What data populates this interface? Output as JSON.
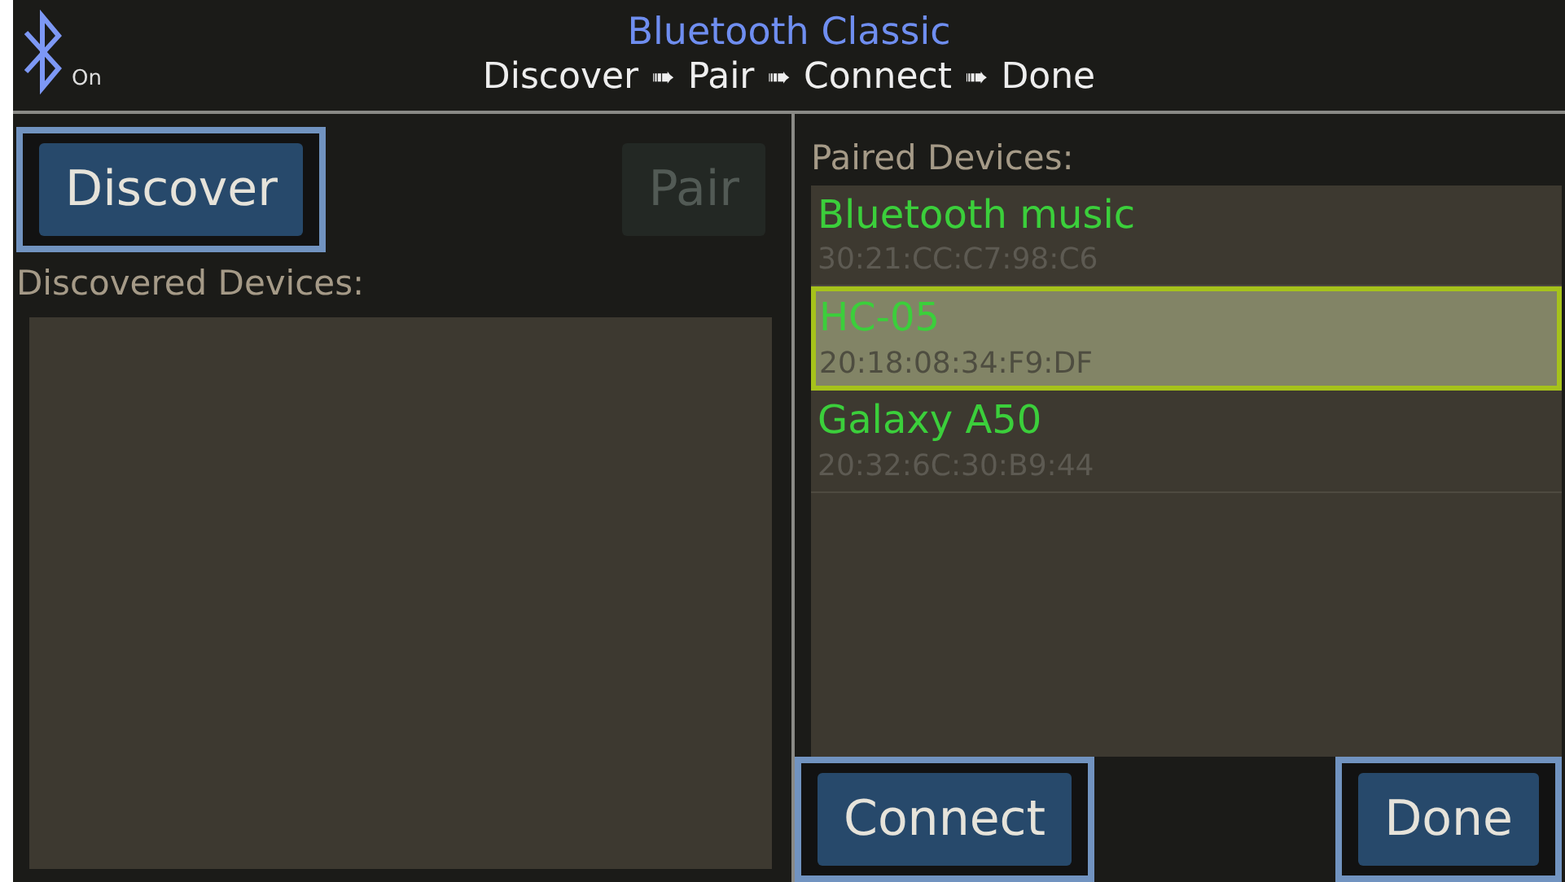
{
  "header": {
    "title": "Bluetooth Classic",
    "bluetooth_status": "On",
    "steps": [
      {
        "label": "Discover",
        "arrow": "➠"
      },
      {
        "label": "Pair",
        "arrow": "➠"
      },
      {
        "label": "Connect",
        "arrow": "➠"
      },
      {
        "label": "Done"
      }
    ]
  },
  "left_panel": {
    "discover_button": {
      "label": "Discover",
      "focused": true,
      "disabled": false
    },
    "pair_button": {
      "label": "Pair",
      "focused": false,
      "disabled": true
    },
    "list_title": "Discovered Devices:"
  },
  "right_panel": {
    "list_title": "Paired Devices:",
    "devices": [
      {
        "name": "Bluetooth music",
        "address": "30:21:CC:C7:98:C6",
        "selected": false
      },
      {
        "name": "HC-05",
        "address": "20:18:08:34:F9:DF",
        "selected": true
      },
      {
        "name": "Galaxy A50",
        "address": "20:32:6C:30:B9:44",
        "selected": false
      }
    ],
    "connect_button": {
      "label": "Connect",
      "focused": true,
      "disabled": false
    },
    "done_button": {
      "label": "Done",
      "focused": true,
      "disabled": false
    }
  }
}
